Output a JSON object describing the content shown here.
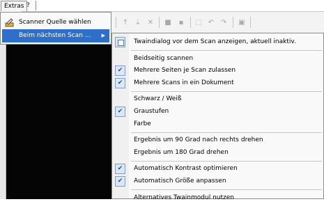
{
  "menubar": {
    "extras_label": "Extras",
    "help_label": "?"
  },
  "extras_menu": {
    "items": [
      {
        "label": "Scanner Quelle wählen",
        "icon": "scanner-edit-icon"
      },
      {
        "label": "Beim nächsten Scan ...",
        "icon": "none",
        "has_submenu": true,
        "highlighted": true
      }
    ]
  },
  "submenu": {
    "items": [
      {
        "label": "Twaindialog vor dem Scan anzeigen, aktuell inaktiv.",
        "marker": "icon",
        "icon": "dialog-icon"
      },
      {
        "label": "Beidseitig scannen",
        "marker": "none"
      },
      {
        "label": "Mehrere Seiten je Scan zulassen",
        "marker": "check"
      },
      {
        "label": "Mehrere Scans in ein Dokument",
        "marker": "check"
      },
      {
        "label": "Schwarz / Weiß",
        "marker": "none"
      },
      {
        "label": "Graustufen",
        "marker": "check"
      },
      {
        "label": "Farbe",
        "marker": "none"
      },
      {
        "label": "Ergebnis um 90 Grad nach rechts drehen",
        "marker": "none"
      },
      {
        "label": "Ergebnis um 180 Grad drehen",
        "marker": "none"
      },
      {
        "label": "Automatisch Kontrast optimieren",
        "marker": "check"
      },
      {
        "label": "Automatisch Größe anpassen",
        "marker": "check"
      },
      {
        "label": "Alternatives Twainmodul nutzen",
        "marker": "none"
      }
    ]
  },
  "colors": {
    "highlight": "#2f6fc7",
    "dark_background": "#050505",
    "check_bg": "#dbe6f6"
  }
}
